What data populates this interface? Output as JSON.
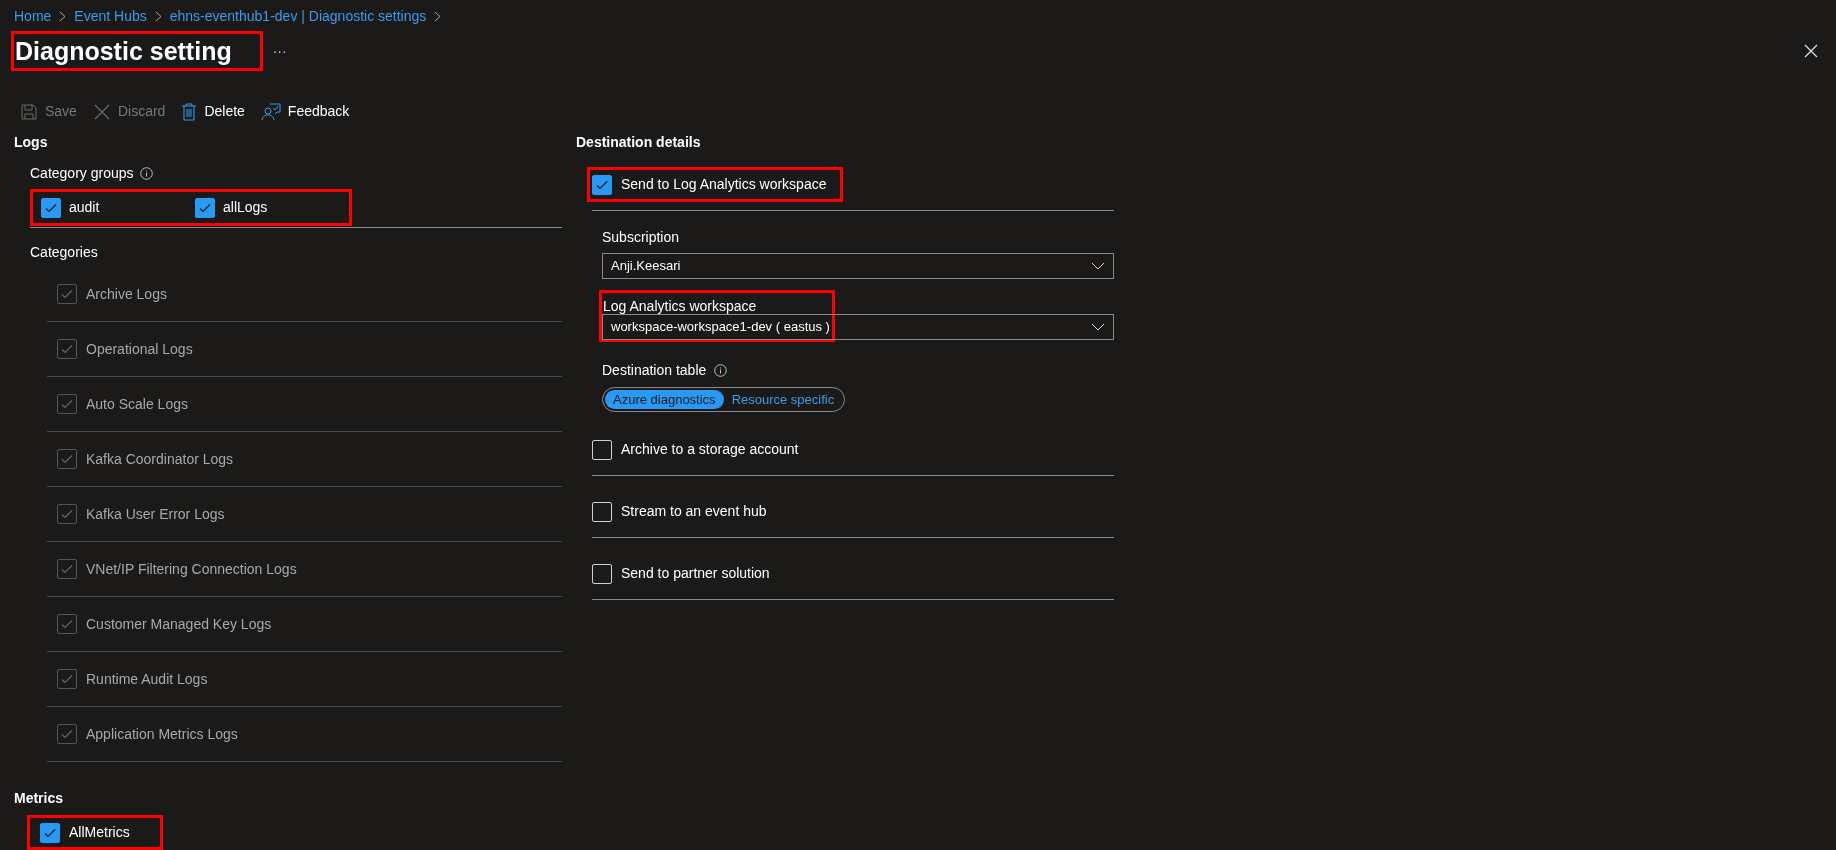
{
  "breadcrumb": [
    "Home",
    "Event Hubs",
    "ehns-eventhub1-dev | Diagnostic settings"
  ],
  "title": {
    "text": "Diagnostic setting",
    "highlighted": true
  },
  "more": "···",
  "toolbar": [
    {
      "kind": "save",
      "label": "Save",
      "disabled": true
    },
    {
      "kind": "discard",
      "label": "Discard",
      "disabled": true
    },
    {
      "kind": "delete",
      "label": "Delete",
      "disabled": false
    },
    {
      "kind": "feedback",
      "label": "Feedback",
      "disabled": false
    }
  ],
  "logs": {
    "title": "Logs",
    "category_groups": {
      "label": "Category groups",
      "highlighted": true,
      "items": [
        {
          "label": "audit",
          "checked": true
        },
        {
          "label": "allLogs",
          "checked": true
        }
      ]
    },
    "categories": {
      "label": "Categories",
      "items": [
        {
          "label": "Archive Logs",
          "checked": true,
          "disabled": true
        },
        {
          "label": "Operational Logs",
          "checked": true,
          "disabled": true
        },
        {
          "label": "Auto Scale Logs",
          "checked": true,
          "disabled": true
        },
        {
          "label": "Kafka Coordinator Logs",
          "checked": true,
          "disabled": true
        },
        {
          "label": "Kafka User Error Logs",
          "checked": true,
          "disabled": true
        },
        {
          "label": "VNet/IP Filtering Connection Logs",
          "checked": true,
          "disabled": true
        },
        {
          "label": "Customer Managed Key Logs",
          "checked": true,
          "disabled": true
        },
        {
          "label": "Runtime Audit Logs",
          "checked": true,
          "disabled": true
        },
        {
          "label": "Application Metrics Logs",
          "checked": true,
          "disabled": true
        }
      ]
    }
  },
  "metrics": {
    "title": "Metrics",
    "items": [
      {
        "label": "AllMetrics",
        "checked": true,
        "highlighted": true
      }
    ]
  },
  "destination": {
    "title": "Destination details",
    "options": [
      {
        "label": "Send to Log Analytics workspace",
        "checked": true,
        "highlighted": true,
        "details": {
          "subscription": {
            "label": "Subscription",
            "value": "Anji.Keesari"
          },
          "workspace": {
            "label": "Log Analytics workspace",
            "value": "workspace-workspace1-dev ( eastus )",
            "highlighted": true
          },
          "table": {
            "label": "Destination table",
            "options": [
              {
                "label": "Azure diagnostics",
                "selected": true
              },
              {
                "label": "Resource specific",
                "selected": false
              }
            ]
          }
        }
      },
      {
        "label": "Archive to a storage account",
        "checked": false,
        "highlighted": false
      },
      {
        "label": "Stream to an event hub",
        "checked": false,
        "highlighted": false
      },
      {
        "label": "Send to partner solution",
        "checked": false,
        "highlighted": false
      }
    ]
  }
}
